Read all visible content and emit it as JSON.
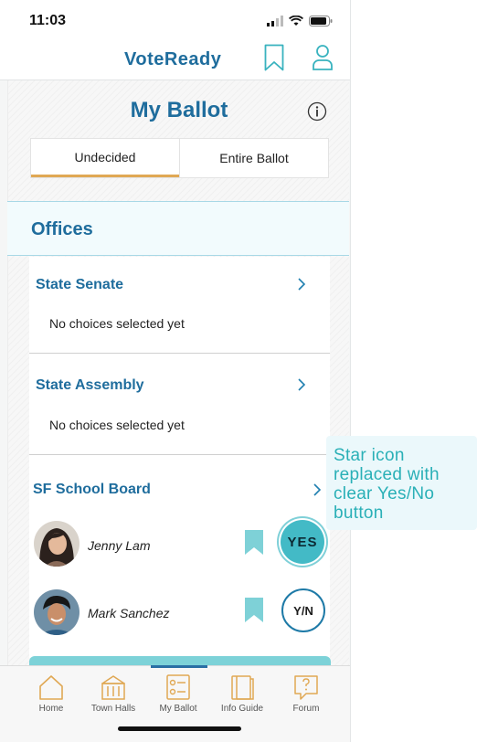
{
  "status_bar": {
    "time": "11:03"
  },
  "app": {
    "title": "VoteReady"
  },
  "ballot": {
    "title": "My Ballot",
    "tabs": [
      {
        "label": "Undecided",
        "active": true
      },
      {
        "label": "Entire Ballot",
        "active": false
      }
    ]
  },
  "offices": {
    "section_label": "Offices",
    "list": [
      {
        "name": "State Senate",
        "status": "No choices selected yet"
      },
      {
        "name": "State Assembly",
        "status": "No choices selected yet"
      }
    ],
    "school_board": {
      "name": "SF School Board",
      "candidates": [
        {
          "name": "Jenny Lam",
          "vote_label": "YES",
          "vote_state": "yes",
          "bookmarked": true
        },
        {
          "name": "Mark Sanchez",
          "vote_label": "Y/N",
          "vote_state": "undecided",
          "bookmarked": true
        }
      ]
    }
  },
  "nav": {
    "items": [
      {
        "label": "Home",
        "icon": "home-icon"
      },
      {
        "label": "Town Halls",
        "icon": "town-hall-icon"
      },
      {
        "label": "My Ballot",
        "icon": "ballot-icon",
        "active": true
      },
      {
        "label": "Info Guide",
        "icon": "book-icon"
      },
      {
        "label": "Forum",
        "icon": "forum-icon"
      }
    ]
  },
  "annotation": {
    "text": "Star icon replaced with clear Yes/No button"
  },
  "colors": {
    "brand_blue": "#1f6d9d",
    "teal": "#43bac6",
    "tab_accent": "#e0a854",
    "nav_icon": "#e0a854",
    "callout_text": "#2ab0b7"
  }
}
